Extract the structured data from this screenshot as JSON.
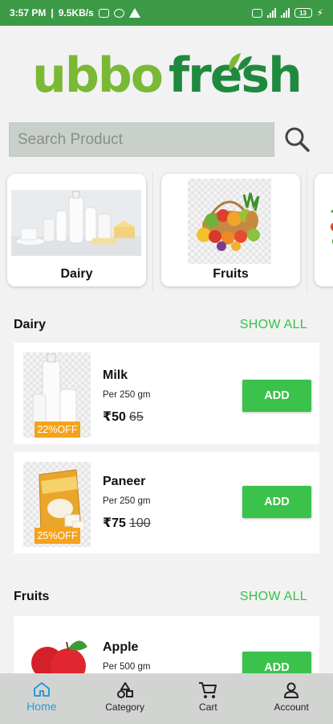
{
  "status_bar": {
    "time": "3:57 PM",
    "speed": "9.5KB/s",
    "battery": "13"
  },
  "brand": {
    "part1": "ubbo",
    "part2": "fresh"
  },
  "search": {
    "placeholder": "Search Product"
  },
  "categories": [
    {
      "label": "Dairy"
    },
    {
      "label": "Fruits"
    }
  ],
  "sections": [
    {
      "title": "Dairy",
      "show_all": "SHOW ALL",
      "products": [
        {
          "name": "Milk",
          "unit": "Per  250 gm",
          "price": "₹50",
          "mrp": "65",
          "discount": "22%OFF",
          "add": "ADD"
        },
        {
          "name": "Paneer",
          "unit": "Per  250 gm",
          "price": "₹75",
          "mrp": "100",
          "discount": "25%OFF",
          "add": "ADD"
        }
      ]
    },
    {
      "title": "Fruits",
      "show_all": "SHOW ALL",
      "products": [
        {
          "name": "Apple",
          "unit": "Per  500 gm",
          "add": "ADD"
        }
      ]
    }
  ],
  "nav": [
    {
      "label": "Home",
      "icon": "home-icon"
    },
    {
      "label": "Category",
      "icon": "category-icon"
    },
    {
      "label": "Cart",
      "icon": "cart-icon"
    },
    {
      "label": "Account",
      "icon": "account-icon"
    }
  ],
  "colors": {
    "status_bar": "#3c9a46",
    "accent_green": "#3ac24b",
    "discount_orange": "#f5a31a",
    "nav_active": "#2a9bd6"
  }
}
